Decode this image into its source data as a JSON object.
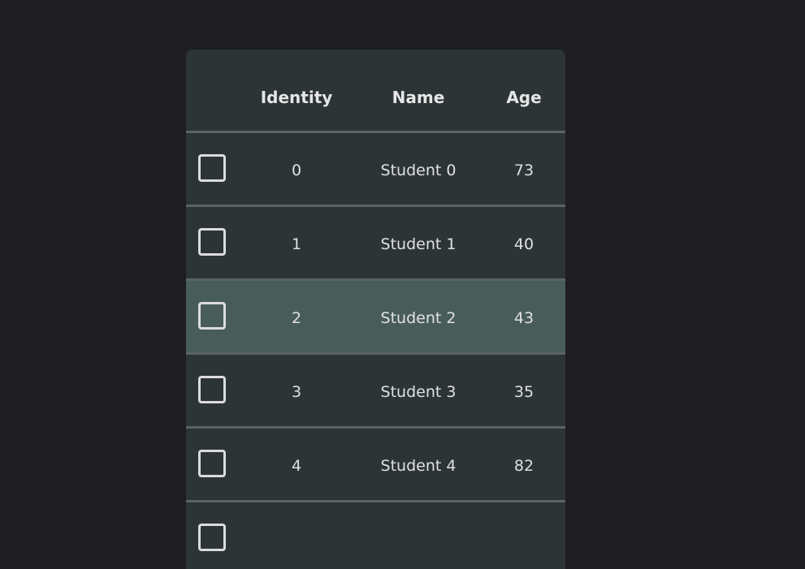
{
  "table": {
    "columns": {
      "identity": "Identity",
      "name": "Name",
      "age": "Age"
    },
    "selected_row_index": 2,
    "rows": [
      {
        "identity": "0",
        "name": "Student 0",
        "age": "73",
        "checked": false
      },
      {
        "identity": "1",
        "name": "Student 1",
        "age": "40",
        "checked": false
      },
      {
        "identity": "2",
        "name": "Student 2",
        "age": "43",
        "checked": false
      },
      {
        "identity": "3",
        "name": "Student 3",
        "age": "35",
        "checked": false
      },
      {
        "identity": "4",
        "name": "Student 4",
        "age": "82",
        "checked": false
      }
    ]
  },
  "colors": {
    "page_background": "#1e1e20",
    "table_background": "#2c3436",
    "row_highlight": "#485d59",
    "divider": "#5b6366",
    "text": "#e0e0e0"
  }
}
